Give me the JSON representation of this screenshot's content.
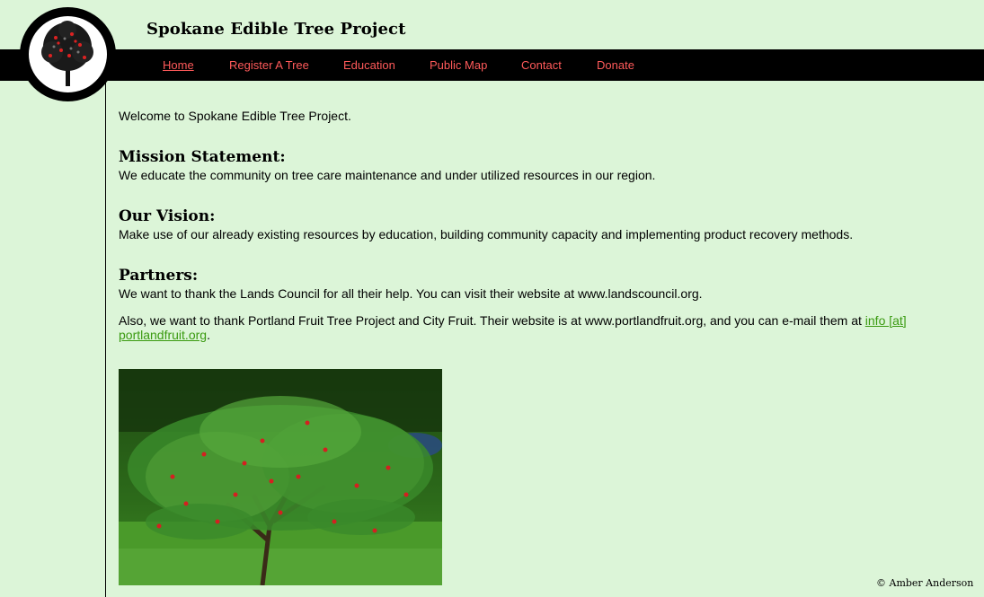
{
  "header": {
    "title": "Spokane Edible Tree Project"
  },
  "nav": {
    "items": [
      {
        "label": "Home"
      },
      {
        "label": "Register A Tree"
      },
      {
        "label": "Education"
      },
      {
        "label": "Public Map"
      },
      {
        "label": "Contact"
      },
      {
        "label": "Donate"
      }
    ]
  },
  "main": {
    "welcome": "Welcome to Spokane Edible Tree Project.",
    "mission_heading": "Mission Statement:",
    "mission_text": "We educate the community on tree care maintenance and under utilized resources in our region.",
    "vision_heading": "Our Vision:",
    "vision_text": "Make use of our already existing resources by education, building community capacity and implementing product recovery methods.",
    "partners_heading": "Partners:",
    "partners_text1": "We want to thank the Lands Council for all their help. You can visit their website at www.landscouncil.org.",
    "partners_text2": "Also, we want to thank Portland Fruit Tree Project and City Fruit. Their website is at www.portlandfruit.org, and you can e-mail them at ",
    "email_link": "info [at] portlandfruit.org",
    "partners_text2_end": "."
  },
  "footer": {
    "copyright": "© Amber Anderson"
  },
  "colors": {
    "background": "#dcf5d8",
    "nav_bar": "#000000",
    "nav_link": "#ff5a5a",
    "link_green": "#3a9a10"
  }
}
